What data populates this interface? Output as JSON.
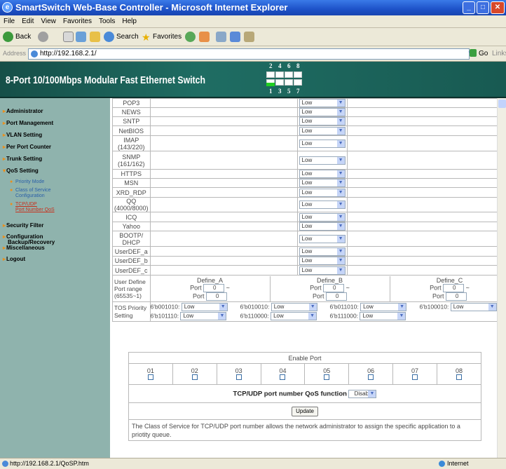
{
  "window": {
    "title": "SmartSwitch Web-Base Controller - Microsoft Internet Explorer"
  },
  "menu": [
    "File",
    "Edit",
    "View",
    "Favorites",
    "Tools",
    "Help"
  ],
  "toolbar": {
    "back": "Back",
    "search": "Search",
    "favorites": "Favorites"
  },
  "address": {
    "label": "Address",
    "url": "http://192.168.2.1/",
    "go": "Go",
    "links": "Links"
  },
  "banner": {
    "title": "8-Port 10/100Mbps Modular Fast Ethernet Switch",
    "ports_top": [
      "2",
      "4",
      "6",
      "8"
    ],
    "ports_bottom": [
      "1",
      "3",
      "5",
      "7"
    ]
  },
  "sidebar": {
    "items": [
      "Administrator",
      "Port Management",
      "VLAN Setting",
      "Per Port Counter",
      "Trunk Setting",
      "QoS Setting",
      "Security Filter",
      "Configuration",
      "Backup/Recovery",
      "Miscellaneous",
      "Logout"
    ],
    "qos_sub": [
      [
        "Priority Mode"
      ],
      [
        "Class of Service",
        "Configuration"
      ],
      [
        "TCP/UDP",
        "Port Number QoS"
      ]
    ]
  },
  "rows": [
    {
      "name": [
        "POP3"
      ],
      "value": "Low"
    },
    {
      "name": [
        "NEWS"
      ],
      "value": "Low"
    },
    {
      "name": [
        "SNTP"
      ],
      "value": "Low"
    },
    {
      "name": [
        "NetBIOS"
      ],
      "value": "Low"
    },
    {
      "name": [
        "IMAP",
        "(143/220)"
      ],
      "value": "Low"
    },
    {
      "name": [
        "SNMP",
        "(161/162)"
      ],
      "value": "Low"
    },
    {
      "name": [
        "HTTPS"
      ],
      "value": "Low"
    },
    {
      "name": [
        "MSN"
      ],
      "value": "Low"
    },
    {
      "name": [
        "XRD_RDP"
      ],
      "value": "Low"
    },
    {
      "name": [
        "QQ",
        "(4000/8000)"
      ],
      "value": "Low"
    },
    {
      "name": [
        "ICQ"
      ],
      "value": "Low"
    },
    {
      "name": [
        "Yahoo"
      ],
      "value": "Low"
    },
    {
      "name": [
        "BOOTP/",
        "DHCP"
      ],
      "value": "Low"
    },
    {
      "name": [
        "UserDEF_a"
      ],
      "value": "Low"
    },
    {
      "name": [
        "UserDEF_b"
      ],
      "value": "Low"
    },
    {
      "name": [
        "UserDEF_c"
      ],
      "value": "Low"
    }
  ],
  "user_define": {
    "label": [
      "User Define",
      "Port range",
      "(65535~1)"
    ],
    "port_label": "Port",
    "groups": [
      {
        "name": "Define_A",
        "p1": "0",
        "p2": "0"
      },
      {
        "name": "Define_B",
        "p1": "0",
        "p2": "0"
      },
      {
        "name": "Define_C",
        "p1": "0",
        "p2": "0"
      }
    ]
  },
  "tos": {
    "label": [
      "TOS Priority",
      "Setting"
    ],
    "row1": [
      {
        "code": "6'b001010:",
        "value": "Low"
      },
      {
        "code": "6'b010010:",
        "value": "Low"
      },
      {
        "code": "6'b011010:",
        "value": "Low"
      },
      {
        "code": "6'b100010:",
        "value": "Low"
      }
    ],
    "row2": [
      {
        "code": "6'b101110:",
        "value": "Low"
      },
      {
        "code": "6'b110000:",
        "value": "Low"
      },
      {
        "code": "6'b111000:",
        "value": "Low"
      }
    ]
  },
  "enable_port": {
    "title": "Enable Port",
    "ports": [
      "01",
      "02",
      "03",
      "04",
      "05",
      "06",
      "07",
      "08"
    ]
  },
  "qos_function": {
    "label": "TCP/UDP port number QoS function",
    "value": "Disable"
  },
  "update_button": "Update",
  "description": "The Class of Service for TCP/UDP port number allows the network administrator to assign the specific application to a priotity queue.",
  "status": {
    "url": "http://192.168.2.1/QoSP.htm",
    "zone": "Internet"
  },
  "colors": {
    "banner": "#1f6d63",
    "sidebar": "#8fb3ad",
    "accent": "#e89020"
  }
}
